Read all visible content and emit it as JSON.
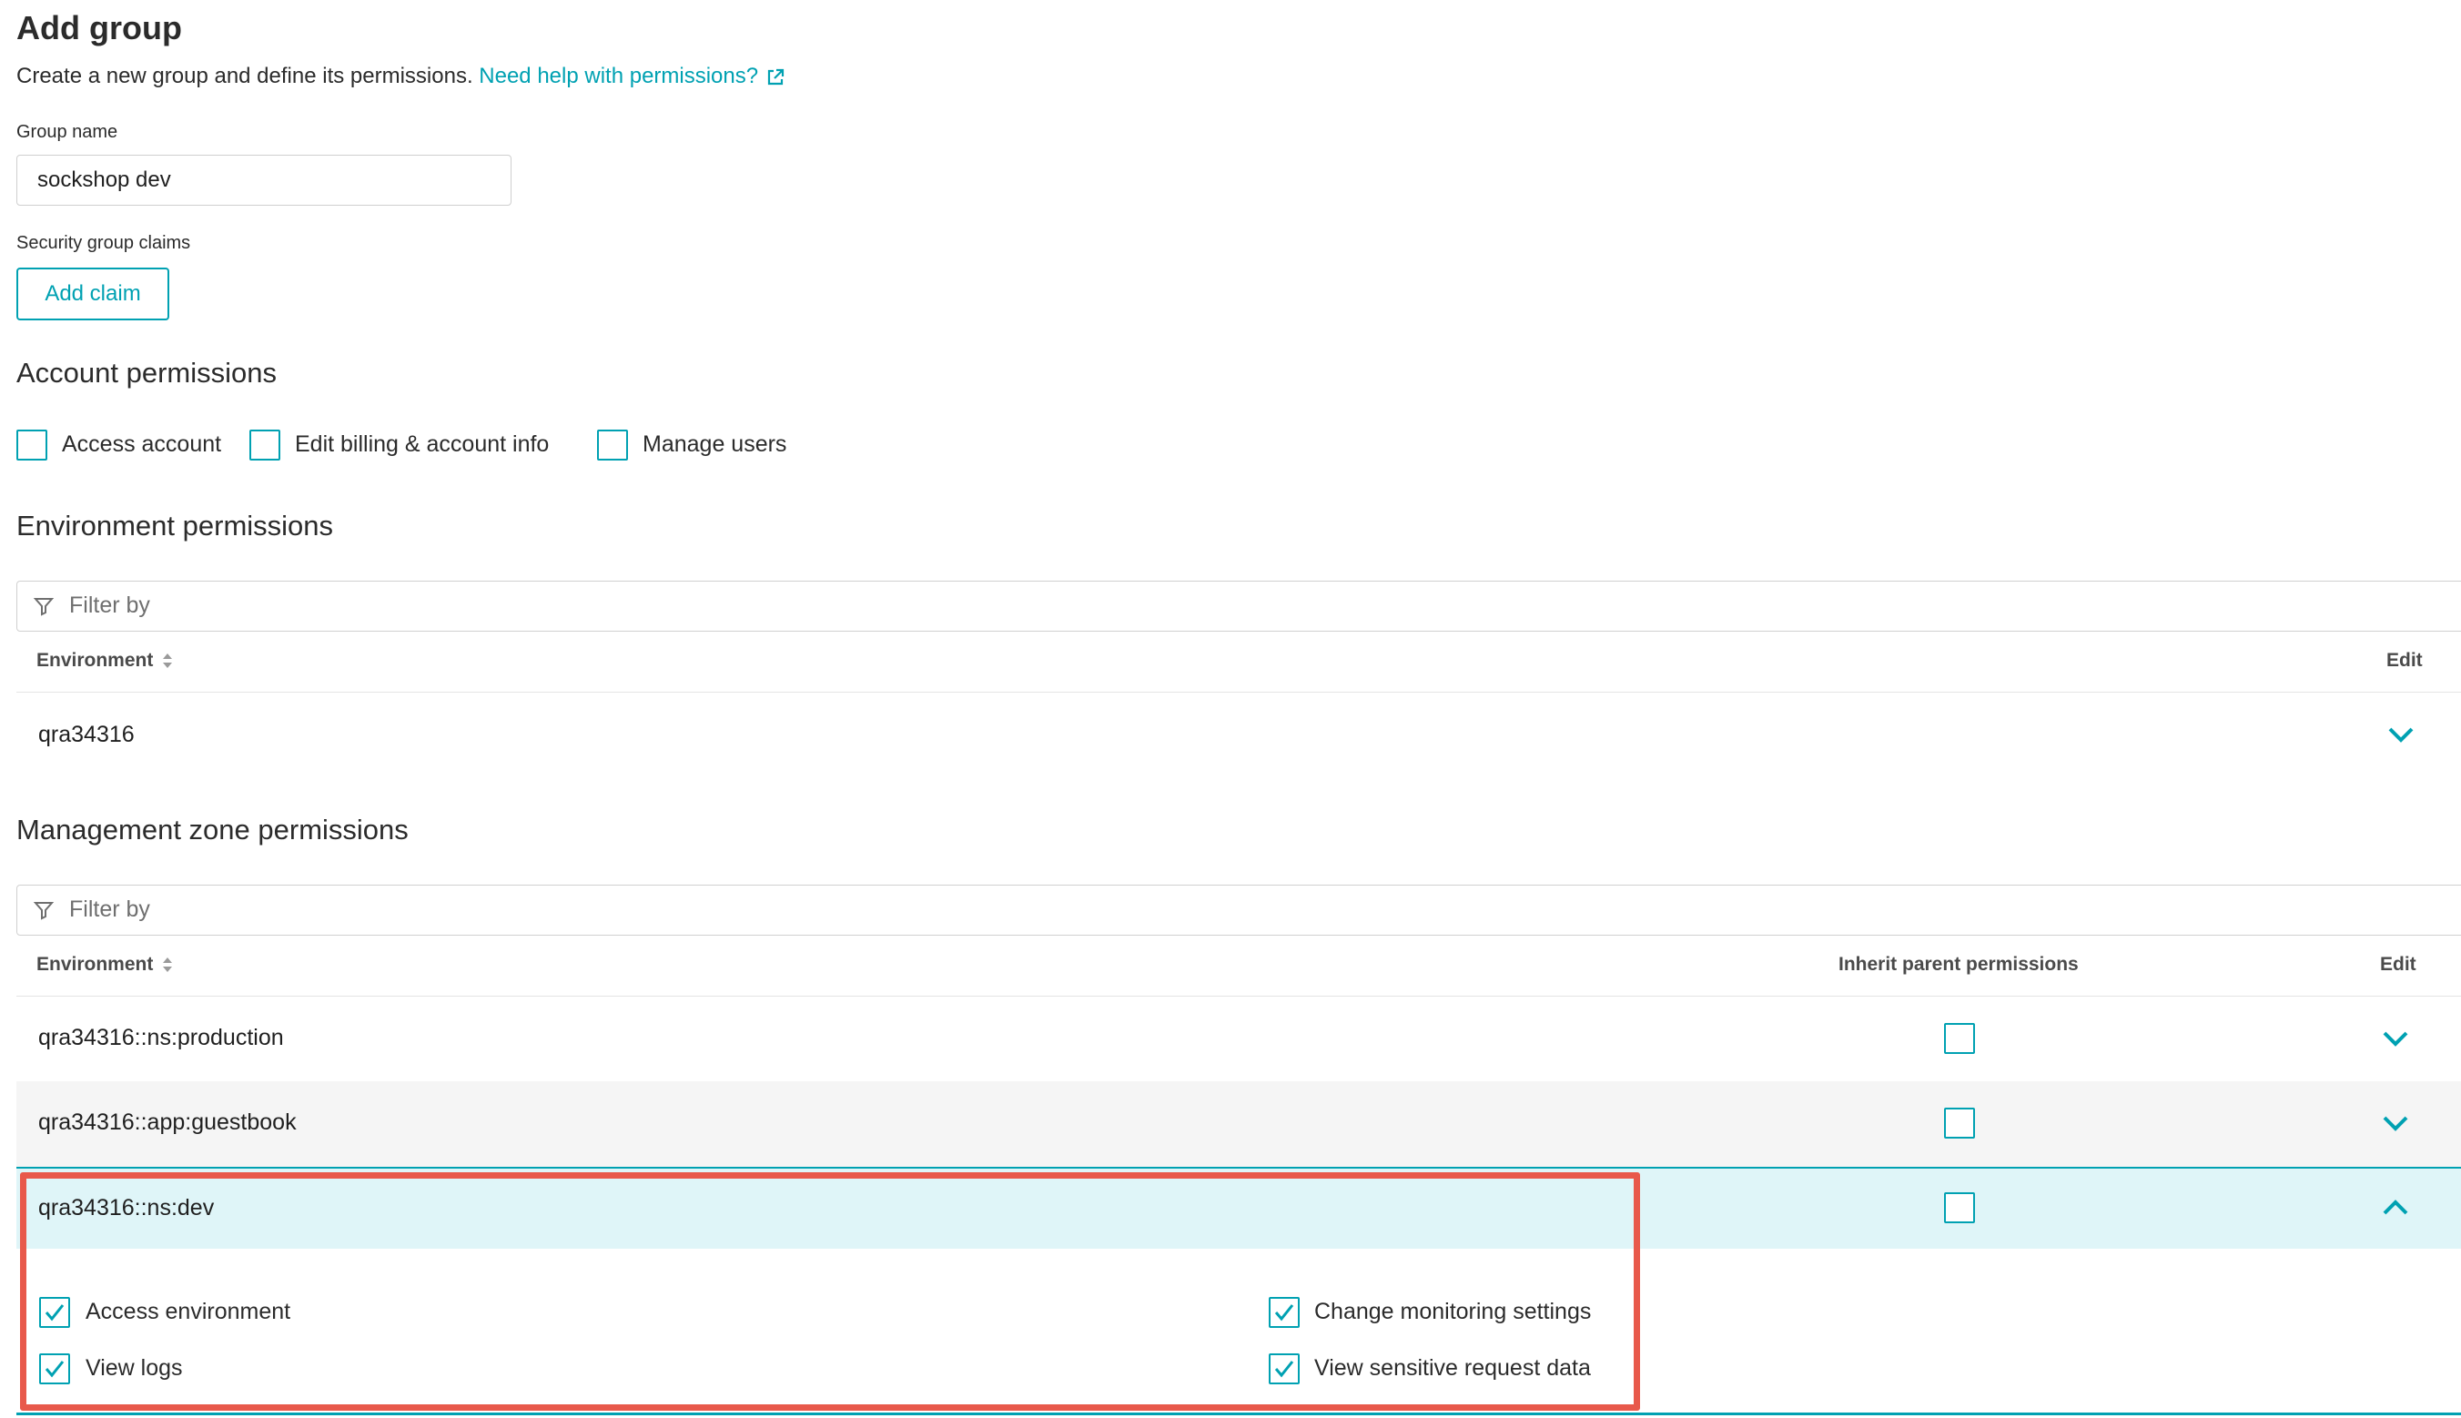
{
  "header": {
    "title": "Add group",
    "description": "Create a new group and define its permissions.",
    "help_link": "Need help with permissions?"
  },
  "group_name": {
    "label": "Group name",
    "value": "sockshop dev"
  },
  "claims": {
    "label": "Security group claims",
    "add_button": "Add claim"
  },
  "account_permissions": {
    "heading": "Account permissions",
    "items": [
      {
        "label": "Access account",
        "checked": false
      },
      {
        "label": "Edit billing & account info",
        "checked": false
      },
      {
        "label": "Manage users",
        "checked": false
      }
    ]
  },
  "environment_permissions": {
    "heading": "Environment permissions",
    "filter_placeholder": "Filter by",
    "columns": {
      "environment": "Environment",
      "edit": "Edit"
    },
    "rows": [
      {
        "name": "qra34316"
      }
    ]
  },
  "mz_permissions": {
    "heading": "Management zone permissions",
    "filter_placeholder": "Filter by",
    "columns": {
      "environment": "Environment",
      "inherit": "Inherit parent permissions",
      "edit": "Edit"
    },
    "rows": [
      {
        "name": "qra34316::ns:production",
        "inherit": false,
        "expanded": false
      },
      {
        "name": "qra34316::app:guestbook",
        "inherit": false,
        "expanded": false
      },
      {
        "name": "qra34316::ns:dev",
        "inherit": false,
        "expanded": true
      }
    ],
    "expanded_permissions": [
      {
        "label": "Access environment",
        "checked": true
      },
      {
        "label": "View logs",
        "checked": true
      },
      {
        "label": "Change monitoring settings",
        "checked": true
      },
      {
        "label": "View sensitive request data",
        "checked": true
      }
    ]
  },
  "colors": {
    "accent": "#00a1b2",
    "highlight_border": "#e8594b",
    "expanded_row_bg": "#dff5f8",
    "alt_row_bg": "#f5f5f5"
  },
  "icons": [
    "external-link-icon",
    "filter-icon",
    "sort-icon",
    "chevron-down-icon",
    "chevron-up-icon",
    "check-icon"
  ]
}
